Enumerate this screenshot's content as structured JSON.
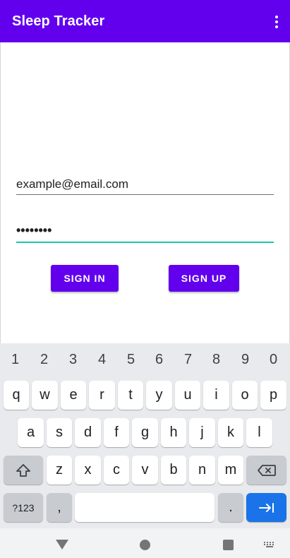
{
  "app": {
    "title": "Sleep Tracker",
    "accent": "#6200ee"
  },
  "form": {
    "email_value": "example@email.com",
    "password_value": "••••••••",
    "focus_underline_color": "#19c7b0"
  },
  "buttons": {
    "sign_in": "SIGN IN",
    "sign_up": "SIGN UP"
  },
  "keyboard": {
    "numbers": [
      "1",
      "2",
      "3",
      "4",
      "5",
      "6",
      "7",
      "8",
      "9",
      "0"
    ],
    "row1": [
      "q",
      "w",
      "e",
      "r",
      "t",
      "y",
      "u",
      "i",
      "o",
      "p"
    ],
    "row2": [
      "a",
      "s",
      "d",
      "f",
      "g",
      "h",
      "j",
      "k",
      "l"
    ],
    "row3": [
      "z",
      "x",
      "c",
      "v",
      "b",
      "n",
      "m"
    ],
    "symbols_label": "?123",
    "comma": ",",
    "period": ".",
    "shift_icon": "shift-icon",
    "backspace_icon": "backspace-icon",
    "enter_icon": "tab-next-icon"
  },
  "navbar": {
    "icons": [
      "back-triangle-icon",
      "home-circle-icon",
      "recents-square-icon",
      "keyboard-switch-icon"
    ]
  }
}
